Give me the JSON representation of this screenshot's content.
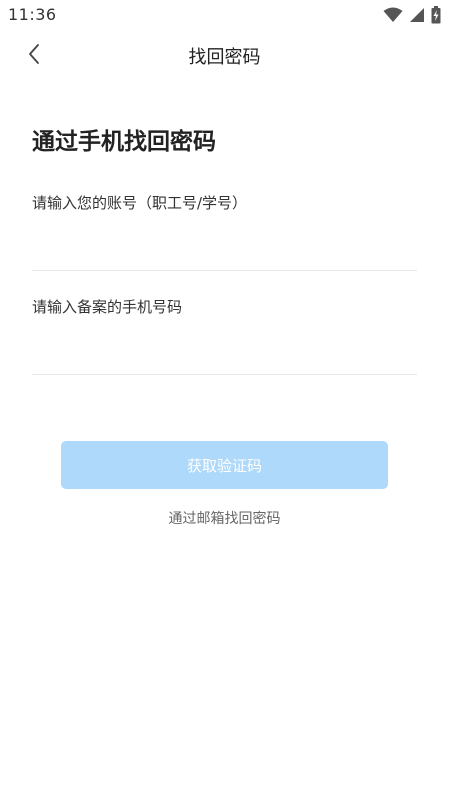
{
  "status_bar": {
    "time": "11:36",
    "icons": [
      "wifi-icon",
      "cellular-signal-icon",
      "battery-charging-icon"
    ]
  },
  "header": {
    "back_icon": "chevron-left-icon",
    "title": "找回密码"
  },
  "main": {
    "heading": "通过手机找回密码",
    "account_field": {
      "label": "请输入您的账号（职工号/学号）",
      "value": "",
      "placeholder": ""
    },
    "phone_field": {
      "label": "请输入备案的手机号码",
      "value": "",
      "placeholder": ""
    },
    "get_code_button": {
      "label": "获取验证码",
      "disabled": true
    },
    "email_recovery_link": "通过邮箱找回密码"
  },
  "colors": {
    "button_disabled_bg": "#aed9fa",
    "button_text": "#ffffff",
    "divider": "#e6e6e6",
    "link_text": "#666666"
  }
}
